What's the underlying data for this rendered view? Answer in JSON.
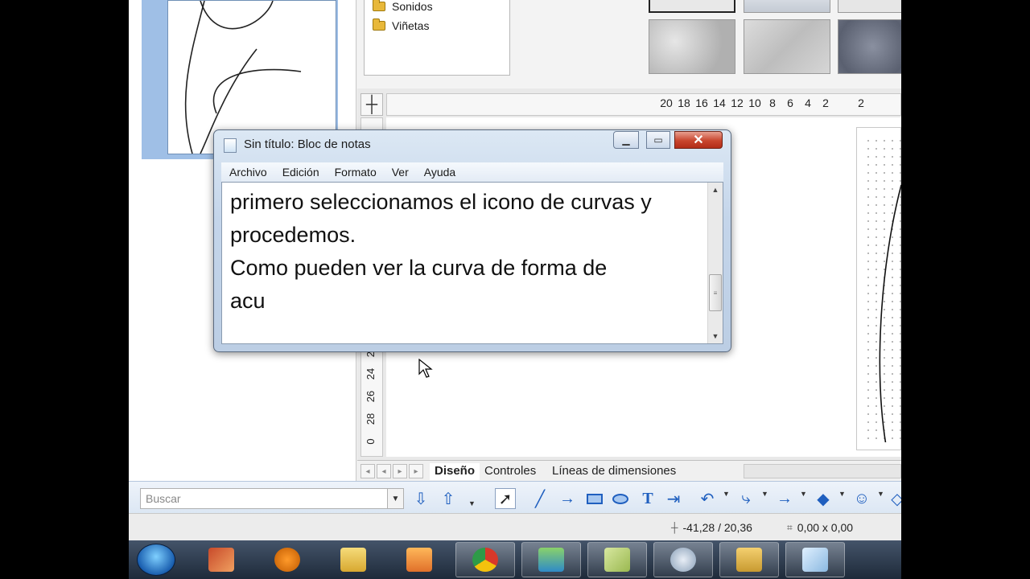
{
  "gallery": {
    "folders": [
      {
        "label": "Sonidos"
      },
      {
        "label": "Viñetas"
      }
    ]
  },
  "ruler": {
    "h_ticks": [
      "20",
      "18",
      "16",
      "14",
      "12",
      "10",
      "8",
      "6",
      "4",
      "2",
      "",
      "2"
    ],
    "v_ticks": [
      "22",
      "24",
      "26",
      "28",
      "0"
    ]
  },
  "notepad": {
    "title": "Sin título: Bloc de notas",
    "menu": [
      "Archivo",
      "Edición",
      "Formato",
      "Ver",
      "Ayuda"
    ],
    "content": "primero seleccionamos el icono de curvas y\nprocedemos.\nComo pueden ver la curva de forma de\nacu"
  },
  "tabs": {
    "diseno": "Diseño",
    "controles": "Controles",
    "lineas": "Líneas de dimensiones"
  },
  "toolbar": {
    "search_placeholder": "Buscar"
  },
  "statusbar": {
    "position": "-41,28 / 20,36",
    "size": "0,00 x 0,00"
  },
  "colors": {
    "accent": "#1f5fbf",
    "close_button": "#c8452e",
    "taskbar": "#1e2a3a"
  },
  "icons": [
    "folder-icon",
    "arrow-down-icon",
    "arrow-up-icon",
    "select-pointer-icon",
    "line-icon",
    "arrow-line-icon",
    "rectangle-icon",
    "ellipse-icon",
    "text-icon",
    "dimension-icon",
    "curve-icon",
    "connector-icon",
    "arrow-icon",
    "diamond-icon",
    "smiley-icon"
  ]
}
